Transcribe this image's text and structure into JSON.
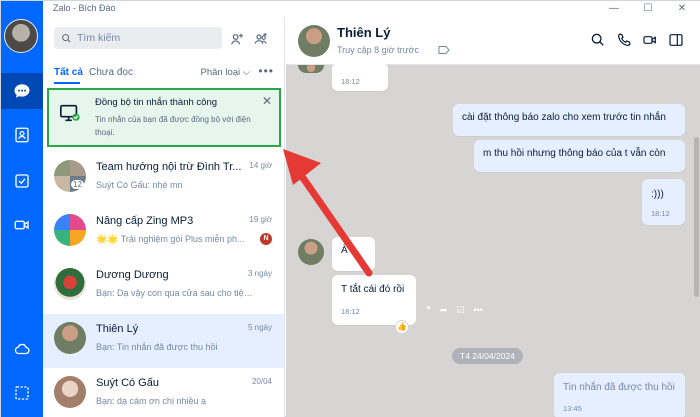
{
  "window": {
    "title": "Zalo - Bích Đào"
  },
  "search": {
    "placeholder": "Tìm kiếm"
  },
  "tabs": [
    {
      "label": "Tất cả",
      "active": true
    },
    {
      "label": "Chưa đọc",
      "active": false
    }
  ],
  "filter_label": "Phân loại",
  "notification": {
    "title": "Đồng bộ tin nhắn thành công",
    "body": "Tin nhắn của bạn đã được đồng bộ với điện thoại."
  },
  "conversations": [
    {
      "name": "Team hướng nội trừ Đình Tr...",
      "time": "14 giờ",
      "preview": "Suýt Có Gấu: nhé mn",
      "member_count": "12"
    },
    {
      "name": "Nâng cấp Zing MP3",
      "time": "19 giờ",
      "preview": "🌟🌟 Trải nghiệm gói Plus miễn ph...",
      "badge": "N"
    },
    {
      "name": "Dương Dương",
      "time": "3 ngày",
      "preview": "Bạn: Dạ vậy con qua cửa sau cho tiện..."
    },
    {
      "name": "Thiên Lý",
      "time": "5 ngày",
      "preview": "Bạn: Tin nhắn đã được thu hồi",
      "active": true
    },
    {
      "name": "Suýt Có Gấu",
      "time": "20/04",
      "preview": "Bạn: dạ cám ơn chị nhiều ạ"
    }
  ],
  "chat": {
    "name": "Thiên Lý",
    "status": "Truy cập 8 giờ trước",
    "messages": [
      {
        "from": "them",
        "time": "18:12"
      },
      {
        "from": "me",
        "text": "cài đặt thông báo zalo cho xem trước tin nhắn"
      },
      {
        "from": "me",
        "text": "m thu hồi nhưng thông báo của t vẫn còn"
      },
      {
        "from": "me",
        "text": ":)))",
        "time": "18:12"
      },
      {
        "from": "them",
        "text": "À"
      },
      {
        "from": "them",
        "text": "T tắt cái đó rồi",
        "time": "18:12"
      },
      {
        "from": "me",
        "text": "Tin nhắn đã được thu hồi",
        "time": "13:45"
      }
    ],
    "date_divider": "T4 24/04/2024"
  },
  "colors": {
    "brand": "#0068ff",
    "sync_border": "#27a745",
    "annotation": "#e53935"
  }
}
